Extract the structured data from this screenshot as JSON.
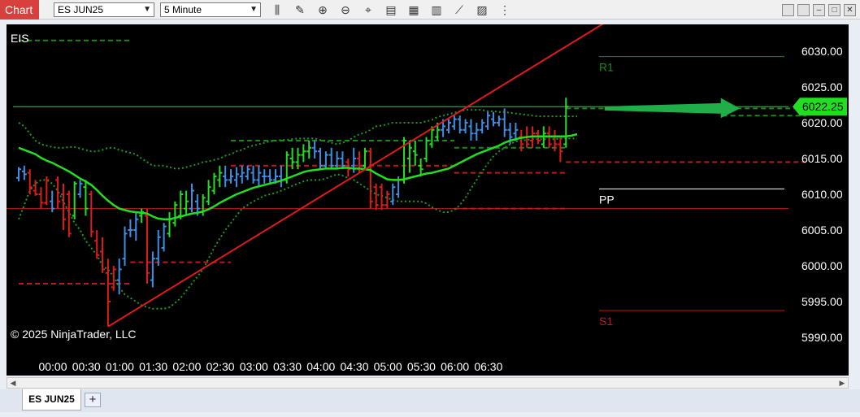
{
  "toolbar": {
    "chart_label": "Chart",
    "instrument": "ES JUN25",
    "interval": "5 Minute",
    "icons": [
      "bars-type-icon",
      "draw-pencil-icon",
      "zoom-in-icon",
      "zoom-out-icon",
      "crosshair-icon",
      "data-box-icon",
      "indicators-icon",
      "strategies-icon",
      "properties-icon",
      "templates-icon"
    ],
    "window_buttons": [
      "tile-icon",
      "snap-icon",
      "minimize-icon",
      "maximize-icon",
      "close-icon"
    ]
  },
  "chart": {
    "indicator_label": "EIS",
    "copyright": "© 2025 NinjaTrader, LLC",
    "price_tag": "6022.25",
    "pivot_labels": {
      "r1": "R1",
      "pp": "PP",
      "s1": "S1"
    },
    "colors": {
      "background": "#000000",
      "up": "#21e021",
      "down": "#e01b1b",
      "neutral": "#3d8fe6",
      "ma": "#22dd22",
      "r1": "#1a8a1a",
      "s1": "#c01818",
      "pp": "#ffffff"
    }
  },
  "chart_data": {
    "type": "candlestick",
    "y_axis": {
      "ticks": [
        "6030.00",
        "6025.00",
        "6020.00",
        "6015.00",
        "6010.00",
        "6005.00",
        "6000.00",
        "5995.00",
        "5990.00"
      ]
    },
    "x_axis": {
      "ticks": [
        "00:00",
        "00:30",
        "01:00",
        "01:30",
        "02:00",
        "02:30",
        "03:00",
        "03:30",
        "04:00",
        "04:30",
        "05:00",
        "05:30",
        "06:00",
        "06:30"
      ]
    },
    "last_price": 6022.25,
    "horizontal_line": 6022.25,
    "pivots": {
      "R1": 6029.25,
      "PP": 6010.75,
      "S1": 5993.75
    },
    "bars": [
      {
        "o": 6012.3,
        "h": 6013.8,
        "l": 6011.8,
        "c": 6013.5,
        "col": "n"
      },
      {
        "o": 6013.2,
        "h": 6014.0,
        "l": 6012.0,
        "c": 6012.8,
        "col": "n"
      },
      {
        "o": 6013.0,
        "h": 6013.5,
        "l": 6010.0,
        "c": 6011.0,
        "col": "d"
      },
      {
        "o": 6010.5,
        "h": 6012.0,
        "l": 6009.8,
        "c": 6010.0,
        "col": "d"
      },
      {
        "o": 6010.0,
        "h": 6011.0,
        "l": 6008.0,
        "c": 6008.8,
        "col": "d"
      },
      {
        "o": 6008.8,
        "h": 6012.5,
        "l": 6008.5,
        "c": 6012.0,
        "col": "d"
      },
      {
        "o": 6009.0,
        "h": 6010.5,
        "l": 6007.5,
        "c": 6008.0,
        "col": "n"
      },
      {
        "o": 6012.0,
        "h": 6012.5,
        "l": 6008.0,
        "c": 6009.0,
        "col": "d"
      },
      {
        "o": 6010.0,
        "h": 6011.5,
        "l": 6005.0,
        "c": 6006.5,
        "col": "d"
      },
      {
        "o": 6010.0,
        "h": 6010.5,
        "l": 6004.0,
        "c": 6004.5,
        "col": "d"
      },
      {
        "o": 6007.0,
        "h": 6011.8,
        "l": 6006.5,
        "c": 6011.5,
        "col": "u"
      },
      {
        "o": 6010.0,
        "h": 6012.0,
        "l": 6009.5,
        "c": 6011.5,
        "col": "n"
      },
      {
        "o": 6011.0,
        "h": 6012.0,
        "l": 6007.0,
        "c": 6008.0,
        "col": "u"
      },
      {
        "o": 6010.0,
        "h": 6010.5,
        "l": 6004.0,
        "c": 6004.8,
        "col": "d"
      },
      {
        "o": 6003.5,
        "h": 6005.0,
        "l": 6001.0,
        "c": 6001.5,
        "col": "d"
      },
      {
        "o": 6002.0,
        "h": 6004.0,
        "l": 5999.0,
        "c": 5999.5,
        "col": "d"
      },
      {
        "o": 5999.0,
        "h": 6001.0,
        "l": 5991.5,
        "c": 5995.0,
        "col": "d"
      },
      {
        "o": 5997.0,
        "h": 6000.0,
        "l": 5996.5,
        "c": 5999.5,
        "col": "d"
      },
      {
        "o": 5998.0,
        "h": 6001.0,
        "l": 5996.0,
        "c": 5999.5,
        "col": "n"
      },
      {
        "o": 6001.0,
        "h": 6005.5,
        "l": 6000.0,
        "c": 6004.5,
        "col": "n"
      },
      {
        "o": 6005.0,
        "h": 6006.5,
        "l": 6004.0,
        "c": 6005.0,
        "col": "n"
      },
      {
        "o": 6005.0,
        "h": 6007.5,
        "l": 6003.5,
        "c": 6006.5,
        "col": "n"
      },
      {
        "o": 6007.0,
        "h": 6008.0,
        "l": 6006.0,
        "c": 6007.5,
        "col": "u"
      },
      {
        "o": 6007.0,
        "h": 6008.0,
        "l": 5997.5,
        "c": 5999.0,
        "col": "d"
      },
      {
        "o": 5998.0,
        "h": 6002.0,
        "l": 5997.0,
        "c": 6001.0,
        "col": "n"
      },
      {
        "o": 6001.0,
        "h": 6005.0,
        "l": 6000.0,
        "c": 6004.0,
        "col": "n"
      },
      {
        "o": 6002.5,
        "h": 6006.0,
        "l": 6002.0,
        "c": 6005.5,
        "col": "n"
      },
      {
        "o": 6004.5,
        "h": 6007.5,
        "l": 6004.0,
        "c": 6006.5,
        "col": "u"
      },
      {
        "o": 6006.0,
        "h": 6009.0,
        "l": 6005.5,
        "c": 6008.5,
        "col": "u"
      },
      {
        "o": 6007.0,
        "h": 6010.5,
        "l": 6006.5,
        "c": 6010.0,
        "col": "u"
      },
      {
        "o": 6008.0,
        "h": 6010.5,
        "l": 6007.0,
        "c": 6009.0,
        "col": "u"
      },
      {
        "o": 6008.0,
        "h": 6011.5,
        "l": 6007.5,
        "c": 6010.5,
        "col": "n"
      },
      {
        "o": 6009.0,
        "h": 6010.0,
        "l": 6007.0,
        "c": 6008.0,
        "col": "n"
      },
      {
        "o": 6007.5,
        "h": 6010.0,
        "l": 6007.0,
        "c": 6009.5,
        "col": "u"
      },
      {
        "o": 6009.0,
        "h": 6012.0,
        "l": 6008.5,
        "c": 6011.0,
        "col": "u"
      },
      {
        "o": 6010.5,
        "h": 6013.0,
        "l": 6010.0,
        "c": 6012.5,
        "col": "u"
      },
      {
        "o": 6012.0,
        "h": 6014.0,
        "l": 6011.0,
        "c": 6013.0,
        "col": "u"
      },
      {
        "o": 6012.5,
        "h": 6014.0,
        "l": 6011.0,
        "c": 6012.0,
        "col": "n"
      },
      {
        "o": 6012.0,
        "h": 6013.5,
        "l": 6011.5,
        "c": 6012.5,
        "col": "n"
      },
      {
        "o": 6012.0,
        "h": 6013.8,
        "l": 6011.0,
        "c": 6012.8,
        "col": "n"
      },
      {
        "o": 6012.5,
        "h": 6014.0,
        "l": 6011.5,
        "c": 6013.0,
        "col": "n"
      },
      {
        "o": 6012.5,
        "h": 6014.0,
        "l": 6012.0,
        "c": 6013.5,
        "col": "n"
      },
      {
        "o": 6013.0,
        "h": 6014.0,
        "l": 6011.5,
        "c": 6012.0,
        "col": "n"
      },
      {
        "o": 6012.0,
        "h": 6014.0,
        "l": 6011.0,
        "c": 6013.0,
        "col": "n"
      },
      {
        "o": 6012.5,
        "h": 6013.5,
        "l": 6011.5,
        "c": 6012.5,
        "col": "n"
      },
      {
        "o": 6012.5,
        "h": 6013.5,
        "l": 6011.5,
        "c": 6012.0,
        "col": "n"
      },
      {
        "o": 6012.0,
        "h": 6013.5,
        "l": 6011.5,
        "c": 6012.5,
        "col": "n"
      },
      {
        "o": 6012.5,
        "h": 6014.0,
        "l": 6011.0,
        "c": 6012.0,
        "col": "n"
      },
      {
        "o": 6012.0,
        "h": 6016.0,
        "l": 6011.5,
        "c": 6015.5,
        "col": "u"
      },
      {
        "o": 6015.0,
        "h": 6016.5,
        "l": 6013.5,
        "c": 6014.5,
        "col": "u"
      },
      {
        "o": 6014.5,
        "h": 6016.5,
        "l": 6013.5,
        "c": 6015.5,
        "col": "u"
      },
      {
        "o": 6015.5,
        "h": 6017.0,
        "l": 6014.5,
        "c": 6016.0,
        "col": "u"
      },
      {
        "o": 6016.0,
        "h": 6017.5,
        "l": 6015.0,
        "c": 6016.5,
        "col": "u"
      },
      {
        "o": 6016.5,
        "h": 6017.5,
        "l": 6015.0,
        "c": 6016.0,
        "col": "n"
      },
      {
        "o": 6016.0,
        "h": 6016.5,
        "l": 6013.5,
        "c": 6014.0,
        "col": "n"
      },
      {
        "o": 6014.0,
        "h": 6016.0,
        "l": 6013.5,
        "c": 6015.5,
        "col": "n"
      },
      {
        "o": 6015.5,
        "h": 6016.5,
        "l": 6013.5,
        "c": 6014.0,
        "col": "n"
      },
      {
        "o": 6014.0,
        "h": 6016.0,
        "l": 6013.5,
        "c": 6015.0,
        "col": "n"
      },
      {
        "o": 6015.0,
        "h": 6016.0,
        "l": 6013.5,
        "c": 6014.0,
        "col": "n"
      },
      {
        "o": 6014.5,
        "h": 6015.0,
        "l": 6012.5,
        "c": 6013.5,
        "col": "d"
      },
      {
        "o": 6014.0,
        "h": 6016.5,
        "l": 6013.0,
        "c": 6015.0,
        "col": "n"
      },
      {
        "o": 6015.0,
        "h": 6016.0,
        "l": 6013.0,
        "c": 6014.0,
        "col": "d"
      },
      {
        "o": 6014.0,
        "h": 6016.5,
        "l": 6013.5,
        "c": 6016.0,
        "col": "u"
      },
      {
        "o": 6016.0,
        "h": 6016.5,
        "l": 6008.0,
        "c": 6009.0,
        "col": "d"
      },
      {
        "o": 6011.0,
        "h": 6011.5,
        "l": 6007.8,
        "c": 6008.5,
        "col": "d"
      },
      {
        "o": 6011.0,
        "h": 6011.5,
        "l": 6007.8,
        "c": 6008.5,
        "col": "d"
      },
      {
        "o": 6008.5,
        "h": 6010.5,
        "l": 6008.0,
        "c": 6010.0,
        "col": "d"
      },
      {
        "o": 6009.0,
        "h": 6011.5,
        "l": 6008.5,
        "c": 6011.0,
        "col": "n"
      },
      {
        "o": 6010.0,
        "h": 6012.5,
        "l": 6009.5,
        "c": 6012.0,
        "col": "n"
      },
      {
        "o": 6012.0,
        "h": 6018.0,
        "l": 6011.5,
        "c": 6017.5,
        "col": "u"
      },
      {
        "o": 6015.0,
        "h": 6017.5,
        "l": 6013.0,
        "c": 6016.5,
        "col": "u"
      },
      {
        "o": 6016.0,
        "h": 6017.5,
        "l": 6014.0,
        "c": 6015.5,
        "col": "u"
      },
      {
        "o": 6014.0,
        "h": 6015.0,
        "l": 6012.5,
        "c": 6013.5,
        "col": "u"
      },
      {
        "o": 6015.0,
        "h": 6018.0,
        "l": 6014.5,
        "c": 6017.5,
        "col": "u"
      },
      {
        "o": 6017.0,
        "h": 6019.5,
        "l": 6016.5,
        "c": 6019.0,
        "col": "u"
      },
      {
        "o": 6018.0,
        "h": 6020.0,
        "l": 6017.5,
        "c": 6019.0,
        "col": "u"
      },
      {
        "o": 6019.0,
        "h": 6020.5,
        "l": 6018.0,
        "c": 6019.5,
        "col": "n"
      },
      {
        "o": 6019.0,
        "h": 6020.5,
        "l": 6018.5,
        "c": 6020.0,
        "col": "n"
      },
      {
        "o": 6019.5,
        "h": 6021.0,
        "l": 6019.0,
        "c": 6020.5,
        "col": "n"
      },
      {
        "o": 6020.5,
        "h": 6021.0,
        "l": 6018.5,
        "c": 6019.0,
        "col": "n"
      },
      {
        "o": 6019.0,
        "h": 6020.5,
        "l": 6018.5,
        "c": 6020.0,
        "col": "n"
      },
      {
        "o": 6019.5,
        "h": 6020.5,
        "l": 6017.5,
        "c": 6018.5,
        "col": "n"
      },
      {
        "o": 6018.5,
        "h": 6020.0,
        "l": 6017.5,
        "c": 6019.0,
        "col": "n"
      },
      {
        "o": 6019.0,
        "h": 6020.5,
        "l": 6018.5,
        "c": 6020.0,
        "col": "n"
      },
      {
        "o": 6019.5,
        "h": 6021.5,
        "l": 6019.0,
        "c": 6021.0,
        "col": "n"
      },
      {
        "o": 6020.5,
        "h": 6021.5,
        "l": 6019.5,
        "c": 6020.0,
        "col": "n"
      },
      {
        "o": 6020.0,
        "h": 6021.0,
        "l": 6019.5,
        "c": 6020.5,
        "col": "n"
      },
      {
        "o": 6020.5,
        "h": 6022.0,
        "l": 6018.0,
        "c": 6019.0,
        "col": "n"
      },
      {
        "o": 6019.0,
        "h": 6020.0,
        "l": 6017.0,
        "c": 6018.0,
        "col": "n"
      },
      {
        "o": 6018.5,
        "h": 6020.0,
        "l": 6017.5,
        "c": 6019.0,
        "col": "n"
      },
      {
        "o": 6018.0,
        "h": 6019.0,
        "l": 6016.0,
        "c": 6017.0,
        "col": "d"
      },
      {
        "o": 6018.0,
        "h": 6019.5,
        "l": 6016.5,
        "c": 6017.0,
        "col": "d"
      },
      {
        "o": 6017.5,
        "h": 6019.5,
        "l": 6016.5,
        "c": 6018.5,
        "col": "d"
      },
      {
        "o": 6018.5,
        "h": 6019.0,
        "l": 6017.0,
        "c": 6017.5,
        "col": "d"
      },
      {
        "o": 6017.0,
        "h": 6019.5,
        "l": 6016.5,
        "c": 6018.5,
        "col": "u"
      },
      {
        "o": 6018.5,
        "h": 6019.5,
        "l": 6016.5,
        "c": 6017.0,
        "col": "d"
      },
      {
        "o": 6018.0,
        "h": 6019.0,
        "l": 6016.0,
        "c": 6017.0,
        "col": "d"
      },
      {
        "o": 6017.0,
        "h": 6018.0,
        "l": 6014.5,
        "c": 6016.0,
        "col": "d"
      },
      {
        "o": 6017.0,
        "h": 6023.5,
        "l": 6016.5,
        "c": 6022.25,
        "col": "u"
      }
    ],
    "moving_average": [
      6016.5,
      6016.2,
      6015.9,
      6015.6,
      6015.1,
      6014.7,
      6014.4,
      6014.0,
      6013.6,
      6013.2,
      6012.7,
      6012.2,
      6011.8,
      6011.3,
      6010.6,
      6009.8,
      6009.1,
      6008.5,
      6008.0,
      6007.8,
      6007.6,
      6007.5,
      6007.4,
      6007.3,
      6006.9,
      6006.6,
      6006.5,
      6006.5,
      6006.7,
      6006.9,
      6007.1,
      6007.3,
      6007.4,
      6007.6,
      6007.9,
      6008.3,
      6008.8,
      6009.2,
      6009.6,
      6010.0,
      6010.3,
      6010.6,
      6010.9,
      6011.1,
      6011.3,
      6011.5,
      6011.7,
      6011.9,
      6012.2,
      6012.5,
      6012.8,
      6013.1,
      6013.3,
      6013.4,
      6013.5,
      6013.6,
      6013.6,
      6013.6,
      6013.7,
      6013.7,
      6013.6,
      6013.6,
      6013.5,
      6013.4,
      6012.9,
      6012.5,
      6012.1,
      6012.0,
      6012.0,
      6012.1,
      6012.3,
      6012.5,
      6012.7,
      6012.9,
      6013.0,
      6013.2,
      6013.4,
      6013.6,
      6014.0,
      6014.4,
      6014.8,
      6015.2,
      6015.6,
      6015.9,
      6016.2,
      6016.5,
      6016.8,
      6017.2,
      6017.5,
      6017.7,
      6017.9,
      6018.0,
      6018.1,
      6018.1,
      6018.1,
      6018.1,
      6018.1,
      6018.1,
      6018.1,
      6018.2,
      6018.4
    ],
    "upper_band": [
      6020,
      6019.5,
      6018.5,
      6017.5,
      6017,
      6016.8,
      6016.6,
      6016.5,
      6016.5,
      6016.6,
      6016.6,
      6016.4,
      6016.2,
      6016,
      6016,
      6016.2,
      6016.5,
      6016.5,
      6016.2,
      6016,
      6015.8,
      6015.6,
      6015,
      6014.5,
      6014,
      6014,
      6014,
      6013.8,
      6013.6,
      6013.6,
      6013.8,
      6014,
      6014.2,
      6014.5,
      6014.6,
      6014.8,
      6015,
      6015.4,
      6015.6,
      6016,
      6016.2,
      6016.6,
      6016.8,
      6017,
      6017.2,
      6017.4,
      6017.5,
      6017.6,
      6017.6,
      6017.7,
      6017.8,
      6017.8,
      6017.8,
      6017.8,
      6017.6,
      6017.4,
      6017.2,
      6017,
      6017.2,
      6017.5,
      6018,
      6018.4,
      6018.6,
      6019,
      6019.5,
      6019.6,
      6019.8,
      6020,
      6020,
      6020,
      6020,
      6020,
      6020,
      6020.2,
      6020.4,
      6020.8,
      6021,
      6021.2,
      6021.4,
      6021.6,
      6021.8,
      6021.8,
      6021.8,
      6021.8,
      6021.6,
      6021.6,
      6021.5,
      6021.5,
      6021.4,
      6021.3,
      6021.2,
      6021.1,
      6021,
      6020.9,
      6020.9,
      6020.9,
      6020.9,
      6020.9,
      6020.9,
      6020.9,
      6020.9
    ],
    "lower_band": [
      6006.5,
      6008.5,
      6010.5,
      6011.5,
      6012,
      6012,
      6011.5,
      6010.5,
      6009,
      6007.5,
      6006,
      6005,
      6003.5,
      6002.5,
      6001.5,
      6000,
      5999.5,
      5998.5,
      5997,
      5996,
      5995.5,
      5995,
      5994.5,
      5994.2,
      5994,
      5994,
      5994,
      5994.2,
      5994.8,
      5995.5,
      5996.5,
      5997.5,
      5998.5,
      5999.5,
      6001,
      6002.5,
      6003.8,
      6005,
      6006,
      6007,
      6008,
      6008.5,
      6009,
      6009.4,
      6009.8,
      6010,
      6010.2,
      6010.5,
      6010.8,
      6011.2,
      6011.5,
      6011.8,
      6012,
      6012,
      6012,
      6012.2,
      6012.5,
      6012.8,
      6012.6,
      6012.3,
      6012,
      6011.5,
      6011,
      6010.5,
      6010,
      6009.8,
      6009.5,
      6009.2,
      6009,
      6009,
      6009,
      6009,
      6009,
      6008.7,
      6008.2,
      6007.8,
      6007.5,
      6007.5,
      6007.8,
      6008.5,
      6009.5,
      6010.8,
      6012,
      6013.2,
      6014.3,
      6015.3,
      6016,
      6016.5,
      6017,
      6017.4,
      6017.5,
      6017.6,
      6017.7,
      6017.7,
      6017.7,
      6017.7,
      6017.7,
      6017.8,
      6017.8,
      6017.8,
      6017.8
    ],
    "level_segments": [
      {
        "y": 6031.5,
        "from": 0,
        "to": 20,
        "color": "#1a8a1a",
        "dash": true
      },
      {
        "y": 5997.5,
        "from": 0,
        "to": 20,
        "color": "#c01818",
        "dash": true
      },
      {
        "y": 6000.5,
        "from": 20,
        "to": 38,
        "color": "#c01818",
        "dash": true
      },
      {
        "y": 6017.5,
        "from": 38,
        "to": 78,
        "color": "#1a8a1a",
        "dash": true
      },
      {
        "y": 6014.0,
        "from": 38,
        "to": 78,
        "color": "#c01818",
        "dash": true
      },
      {
        "y": 6016.5,
        "from": 78,
        "to": 98,
        "color": "#1a8a1a",
        "dash": true
      },
      {
        "y": 6013.0,
        "from": 78,
        "to": 98,
        "color": "#c01818",
        "dash": true
      },
      {
        "y": 6008.0,
        "from": 78,
        "to": 98,
        "color": "#c01818",
        "dash": true
      },
      {
        "y": 6022.0,
        "from": 98,
        "to": 141,
        "color": "#1a8a1a",
        "dash": true
      },
      {
        "y": 6021.0,
        "from": 126,
        "to": 141,
        "color": "#1a8a1a",
        "dash": true
      },
      {
        "y": 6014.5,
        "from": 98,
        "to": 141,
        "color": "#c01818",
        "dash": true
      }
    ],
    "trend_line": {
      "from": {
        "bar": 16,
        "price": 5991.5
      },
      "to": {
        "bar": 105,
        "price": 6034.0
      }
    },
    "red_hline": 6008.0,
    "arrow": {
      "from_bar": 105,
      "to_bar": 129,
      "price": 6022.0
    }
  }
}
